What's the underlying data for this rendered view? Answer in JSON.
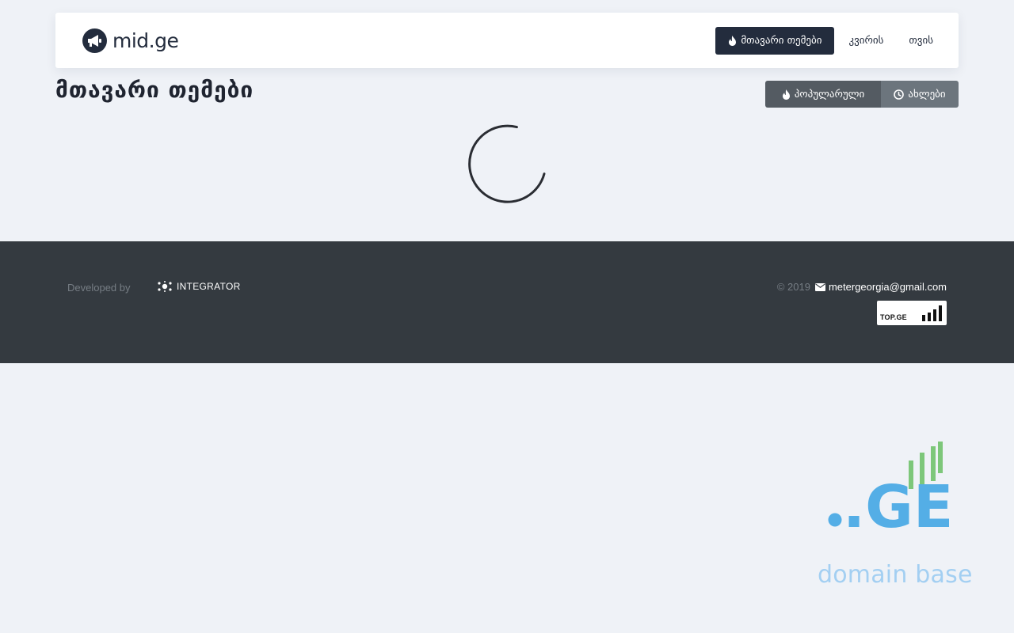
{
  "header": {
    "brand": "mid.ge",
    "nav": [
      {
        "label": "მთავარი თემები",
        "icon": "fire-icon",
        "active": true
      },
      {
        "label": "კვირის"
      },
      {
        "label": "თვის"
      }
    ]
  },
  "main": {
    "title": "მთავარი თემები",
    "sort_buttons": [
      {
        "label": "პოპულარული",
        "icon": "fire-icon"
      },
      {
        "label": "ახლები",
        "icon": "clock-icon"
      }
    ],
    "loading": true
  },
  "footer": {
    "developed_by": "Developed by",
    "developer": "INTEGRATOR",
    "copyright": "© 2019",
    "email": "metergeorgia@gmail.com",
    "counter_badge": "TOP.GE"
  },
  "banner": {
    "domain_logo": ".GE",
    "domain_text": "domain base"
  },
  "colors": {
    "background": "#eff2f7",
    "primary": "#232c3d",
    "footer": "#343a40",
    "button_dark": "#545b62",
    "button_grey": "#6c757d",
    "ge_blue": "#54aee6",
    "ge_green": "#7dc77a"
  }
}
